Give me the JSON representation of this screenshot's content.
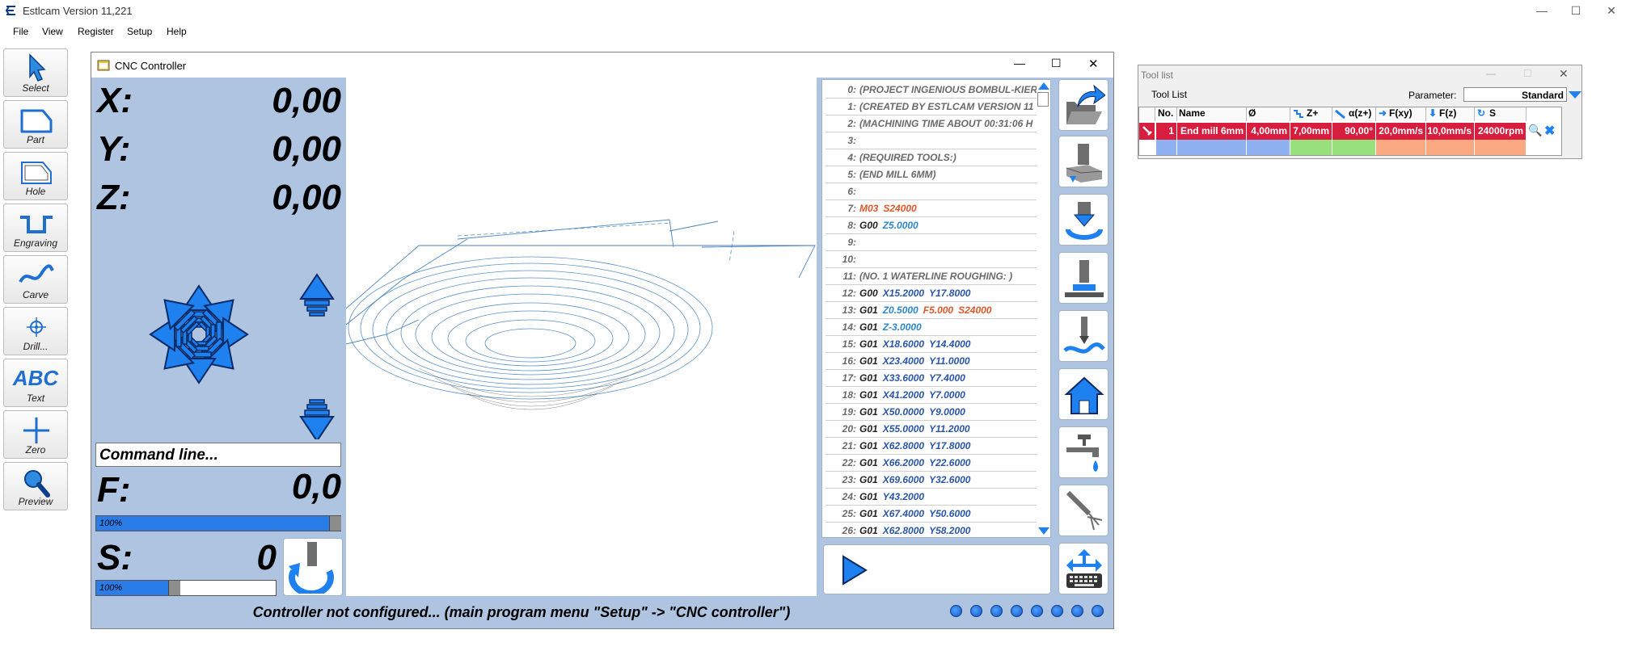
{
  "window": {
    "title": "Estlcam Version 11,221"
  },
  "menu": [
    "File",
    "View",
    "Register",
    "Setup",
    "Help"
  ],
  "toolbar": [
    {
      "label": "Select",
      "icon": "select-arrow-icon"
    },
    {
      "label": "Part",
      "icon": "part-icon"
    },
    {
      "label": "Hole",
      "icon": "hole-icon"
    },
    {
      "label": "Engraving",
      "icon": "engraving-icon"
    },
    {
      "label": "Carve",
      "icon": "carve-icon"
    },
    {
      "label": "Drill...",
      "icon": "drill-icon"
    },
    {
      "label": "Text",
      "icon": "text-icon",
      "icon_text": "ABC"
    },
    {
      "label": "Zero",
      "icon": "zero-icon"
    },
    {
      "label": "Preview",
      "icon": "magnifier-icon"
    }
  ],
  "cnc": {
    "title": "CNC Controller",
    "x_label": "X:",
    "x_value": "0,00",
    "y_label": "Y:",
    "y_value": "0,00",
    "z_label": "Z:",
    "z_value": "0,00",
    "command_placeholder": "Command line...",
    "f_label": "F:",
    "f_value": "0,0",
    "f_override": "100%",
    "f_override_fraction": 1.0,
    "s_label": "S:",
    "s_value": "0",
    "s_override": "100%",
    "s_override_fraction": 0.5,
    "status": "Controller not configured... (main program menu \"Setup\" -> \"CNC controller\")",
    "indicator_count": 8
  },
  "gcode": [
    {
      "n": "0:",
      "words": [
        {
          "t": "(PROJECT INGENIOUS BOMBUL-KIERRE",
          "c": ""
        }
      ]
    },
    {
      "n": "1:",
      "words": [
        {
          "t": "(CREATED BY ESTLCAM VERSION 11",
          "c": ""
        }
      ]
    },
    {
      "n": "2:",
      "words": [
        {
          "t": "(MACHINING TIME ABOUT 00:31:06 H",
          "c": ""
        }
      ]
    },
    {
      "n": "3:",
      "words": []
    },
    {
      "n": "4:",
      "words": [
        {
          "t": "(REQUIRED TOOLS:)",
          "c": ""
        }
      ]
    },
    {
      "n": "5:",
      "words": [
        {
          "t": "(END MILL 6MM)",
          "c": ""
        }
      ]
    },
    {
      "n": "6:",
      "words": []
    },
    {
      "n": "7:",
      "words": [
        {
          "t": "M03",
          "c": "cM"
        },
        {
          "t": "S24000",
          "c": "cF"
        }
      ]
    },
    {
      "n": "8:",
      "words": [
        {
          "t": "G00",
          "c": "cG"
        },
        {
          "t": "Z5.0000",
          "c": "cZ"
        }
      ]
    },
    {
      "n": "9:",
      "words": []
    },
    {
      "n": "10:",
      "words": []
    },
    {
      "n": "11:",
      "words": [
        {
          "t": "(NO. 1 WATERLINE ROUGHING: )",
          "c": ""
        }
      ]
    },
    {
      "n": "12:",
      "words": [
        {
          "t": "G00",
          "c": "cG"
        },
        {
          "t": "X15.2000",
          "c": "cX"
        },
        {
          "t": "Y17.8000",
          "c": "cX"
        }
      ]
    },
    {
      "n": "13:",
      "words": [
        {
          "t": "G01",
          "c": "cG"
        },
        {
          "t": "Z0.5000",
          "c": "cZ"
        },
        {
          "t": "F5.000",
          "c": "cF"
        },
        {
          "t": "S24000",
          "c": "cF"
        }
      ]
    },
    {
      "n": "14:",
      "words": [
        {
          "t": "G01",
          "c": "cG"
        },
        {
          "t": "Z-3.0000",
          "c": "cZ"
        }
      ]
    },
    {
      "n": "15:",
      "words": [
        {
          "t": "G01",
          "c": "cG"
        },
        {
          "t": "X18.6000",
          "c": "cX"
        },
        {
          "t": "Y14.4000",
          "c": "cX"
        }
      ]
    },
    {
      "n": "16:",
      "words": [
        {
          "t": "G01",
          "c": "cG"
        },
        {
          "t": "X23.4000",
          "c": "cX"
        },
        {
          "t": "Y11.0000",
          "c": "cX"
        }
      ]
    },
    {
      "n": "17:",
      "words": [
        {
          "t": "G01",
          "c": "cG"
        },
        {
          "t": "X33.6000",
          "c": "cX"
        },
        {
          "t": "Y7.4000",
          "c": "cX"
        }
      ]
    },
    {
      "n": "18:",
      "words": [
        {
          "t": "G01",
          "c": "cG"
        },
        {
          "t": "X41.2000",
          "c": "cX"
        },
        {
          "t": "Y7.0000",
          "c": "cX"
        }
      ]
    },
    {
      "n": "19:",
      "words": [
        {
          "t": "G01",
          "c": "cG"
        },
        {
          "t": "X50.0000",
          "c": "cX"
        },
        {
          "t": "Y9.0000",
          "c": "cX"
        }
      ]
    },
    {
      "n": "20:",
      "words": [
        {
          "t": "G01",
          "c": "cG"
        },
        {
          "t": "X55.0000",
          "c": "cX"
        },
        {
          "t": "Y11.2000",
          "c": "cX"
        }
      ]
    },
    {
      "n": "21:",
      "words": [
        {
          "t": "G01",
          "c": "cG"
        },
        {
          "t": "X62.8000",
          "c": "cX"
        },
        {
          "t": "Y17.8000",
          "c": "cX"
        }
      ]
    },
    {
      "n": "22:",
      "words": [
        {
          "t": "G01",
          "c": "cG"
        },
        {
          "t": "X66.2000",
          "c": "cX"
        },
        {
          "t": "Y22.6000",
          "c": "cX"
        }
      ]
    },
    {
      "n": "23:",
      "words": [
        {
          "t": "G01",
          "c": "cG"
        },
        {
          "t": "X69.6000",
          "c": "cX"
        },
        {
          "t": "Y32.6000",
          "c": "cX"
        }
      ]
    },
    {
      "n": "24:",
      "words": [
        {
          "t": "G01",
          "c": "cG"
        },
        {
          "t": "Y43.2000",
          "c": "cX"
        }
      ]
    },
    {
      "n": "25:",
      "words": [
        {
          "t": "G01",
          "c": "cG"
        },
        {
          "t": "X67.4000",
          "c": "cX"
        },
        {
          "t": "Y50.6000",
          "c": "cX"
        }
      ]
    },
    {
      "n": "26:",
      "words": [
        {
          "t": "G01",
          "c": "cG"
        },
        {
          "t": "X62.8000",
          "c": "cX"
        },
        {
          "t": "Y58.2000",
          "c": "cX"
        }
      ]
    }
  ],
  "right_buttons": [
    "open-file-icon",
    "mill-workpiece-icon",
    "probe-tool-length-icon",
    "set-zero-height-icon",
    "surface-probe-icon",
    "home-icon",
    "coolant-icon",
    "air-blast-icon",
    "jog-keyboard-icon"
  ],
  "play_icon": "play-icon",
  "toollist": {
    "window_title": "Tool list",
    "panel_title": "Tool List",
    "parameter_label": "Parameter:",
    "parameter_value": "Standard",
    "headers": [
      "No.",
      "Name",
      "Ø",
      "Z+",
      "α(z+)",
      "F(xy)",
      "F(z)",
      "S"
    ],
    "row": {
      "no": "1",
      "name": "End mill 6mm",
      "diameter": "4,00mm",
      "zplus": "7,00mm",
      "angle": "90,00°",
      "fxy": "20,0mm/s",
      "fz": "10,0mm/s",
      "s": "24000rpm"
    },
    "colors": {
      "row": "#d81e3f",
      "name_col": "#8fb1f2",
      "z_col": "#98e07c",
      "f_col": "#f9a882"
    }
  }
}
